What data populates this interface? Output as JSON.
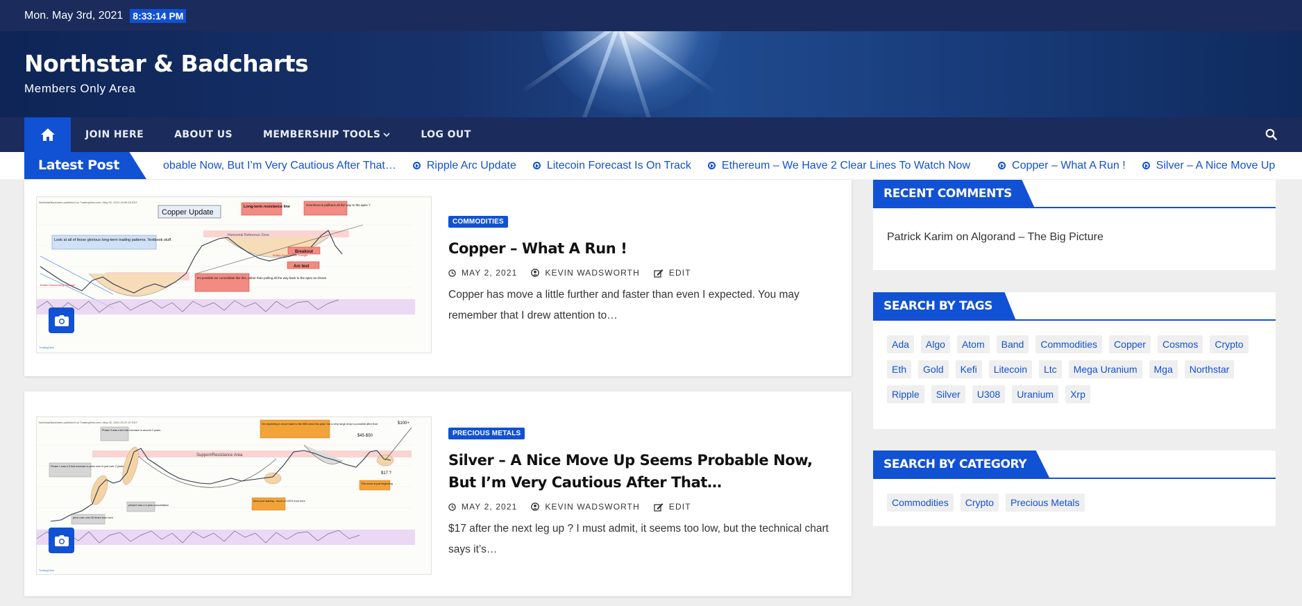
{
  "topbar": {
    "date": "Mon. May 3rd, 2021",
    "time": "8:33:14 PM"
  },
  "site": {
    "title": "Northstar & Badcharts",
    "tagline": "Members Only Area"
  },
  "nav": {
    "items": [
      "JOIN HERE",
      "ABOUT US",
      "MEMBERSHIP TOOLS",
      "LOG OUT"
    ],
    "icons": {
      "home": "home-icon",
      "search": "search-icon",
      "dropdown": "chevron-down-icon"
    }
  },
  "ticker": {
    "label": "Latest Post",
    "items": [
      "obable Now, But I’m Very Cautious After That…",
      "Ripple Arc Update",
      "Litecoin Forecast Is On Track",
      "Ethereum – We Have 2 Clear Lines To Watch Now",
      "Copper – What A Run !",
      "Silver – A Nice Move Up"
    ]
  },
  "posts": [
    {
      "category": "COMMODITIES",
      "title": "Copper – What A Run !",
      "date": "MAY 2, 2021",
      "author": "KEVIN WADSWORTH",
      "edit": "EDIT",
      "excerpt": "Copper has move a little further and faster than even I expected. You may remember that I drew attention to…",
      "image": {
        "header": "NorthstarBadcharts published on TradingView.com, May 02, 2021 19:59:18 EDT",
        "title": "Copper Update",
        "annotations": [
          "Long-term resistance line",
          "Overshoot & pullback all the way to the apex ?",
          "Horizontal Reference Zone",
          "Look at all of those glorious long-term trading patterns. Textbook stuff.",
          "Breakout",
          "Arc test",
          "It's possible we consolidate like this, rather than pulling all the way back to the apex as shown.",
          "Bullish Descending Channel",
          "Bullish Symmetrical Triangle"
        ]
      }
    },
    {
      "category": "PRECIOUS METALS",
      "title": "Silver – A Nice Move Up Seems Probable Now, But I’m Very Cautious After That…",
      "date": "MAY 2, 2021",
      "author": "KEVIN WADSWORTH",
      "edit": "EDIT",
      "excerpt": "$17 after the next leg up ? I must admit, it seems too low, but the technical chart says it’s…",
      "image": {
        "header": "NorthstarBadcharts published on TradingView.com, May 02, 2021 20:37:47 EDT",
        "title": "Support/Resistance Area",
        "annotations": [
          "I'm expecting a move back to the $50 area this year, but a very large drop is possible after that",
          "$45-$50",
          "$100+",
          "$17 ?",
          "This move is just beginning",
          "Phase 1 was a 5 fold increase in price over in just over 2 years",
          "Phase 3 was a ten fold increase in around 2 years",
          "phase2 was a 4 year consolidation",
          "price rose over 30 times from here",
          "Move just starting - much of 100% from here"
        ]
      }
    }
  ],
  "sidebar": {
    "recent_comments": {
      "title": "RECENT COMMENTS",
      "author": "Patrick Karim",
      "on": "on",
      "post": "Algorand – The Big Picture"
    },
    "tags": {
      "title": "SEARCH BY TAGS",
      "items": [
        "Ada",
        "Algo",
        "Atom",
        "Band",
        "Commodities",
        "Copper",
        "Cosmos",
        "Crypto",
        "Eth",
        "Gold",
        "Kefi",
        "Litecoin",
        "Ltc",
        "Mega Uranium",
        "Mga",
        "Northstar",
        "Ripple",
        "Silver",
        "U308",
        "Uranium",
        "Xrp"
      ]
    },
    "categories": {
      "title": "SEARCH BY CATEGORY",
      "items": [
        "Commodities",
        "Crypto",
        "Precious Metals"
      ]
    }
  },
  "colors": {
    "accent": "#1151d3",
    "navy": "#1b2b5c"
  }
}
